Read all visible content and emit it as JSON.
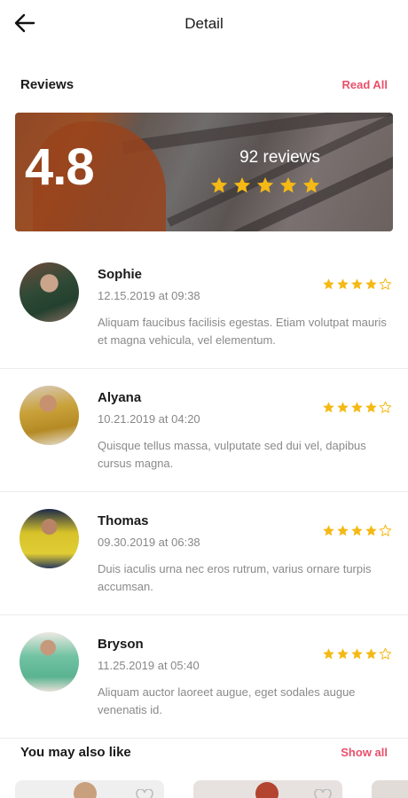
{
  "header": {
    "title": "Detail",
    "back_icon": "arrow-left-icon"
  },
  "reviews_section": {
    "title": "Reviews",
    "action": "Read All"
  },
  "summary": {
    "rating": "4.8",
    "count_label": "92 reviews",
    "stars": 5,
    "star_color": "#f5b915"
  },
  "reviews": [
    {
      "name": "Sophie",
      "date": "12.15.2019 at 09:38",
      "rating": 4,
      "text": "Aliquam faucibus facilisis egestas. Etiam volutpat mauris et magna vehicula, vel elementum."
    },
    {
      "name": "Alyana",
      "date": "10.21.2019 at 04:20",
      "rating": 4,
      "text": "Quisque tellus massa, vulputate sed dui vel, dapibus cursus magna."
    },
    {
      "name": "Thomas",
      "date": "09.30.2019 at 06:38",
      "rating": 4,
      "text": "Duis iaculis urna nec eros rutrum, varius ornare turpis accumsan."
    },
    {
      "name": "Bryson",
      "date": "11.25.2019 at 05:40",
      "rating": 4,
      "text": "Aliquam auctor laoreet augue, eget sodales augue venenatis id."
    }
  ],
  "related_section": {
    "title": "You may also like",
    "action": "Show all"
  },
  "colors": {
    "accent": "#e8506a",
    "star": "#f5b915"
  }
}
